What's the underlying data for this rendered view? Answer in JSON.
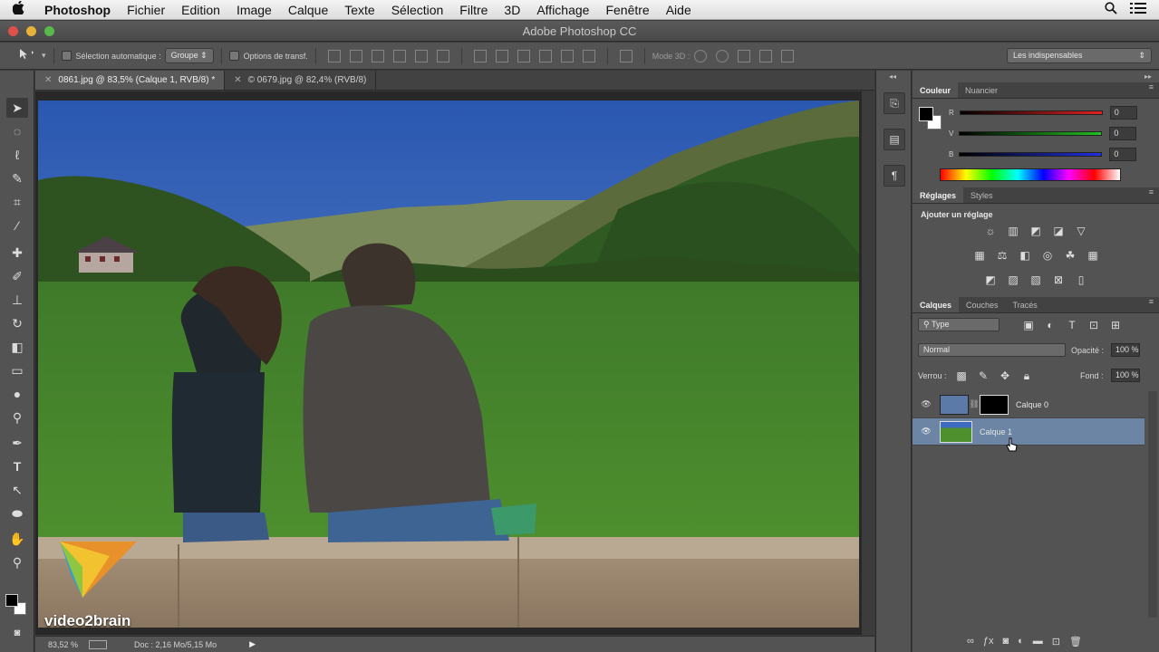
{
  "menubar": {
    "app": "Photoshop",
    "items": [
      "Fichier",
      "Edition",
      "Image",
      "Calque",
      "Texte",
      "Sélection",
      "Filtre",
      "3D",
      "Affichage",
      "Fenêtre",
      "Aide"
    ]
  },
  "window": {
    "title": "Adobe Photoshop CC"
  },
  "options_bar": {
    "auto_select_label": "Sélection automatique :",
    "auto_select_value": "Groupe",
    "transform_label": "Options de transf.",
    "mode3d_label": "Mode 3D :",
    "workspace": "Les indispensables"
  },
  "doc_tabs": [
    {
      "label": "0861.jpg @ 83,5% (Calque 1, RVB/8) *",
      "active": true
    },
    {
      "label": "© 0679.jpg @ 82,4% (RVB/8)",
      "active": false
    }
  ],
  "status_bar": {
    "zoom": "83,52 %",
    "doc": "Doc : 2,16 Mo/5,15 Mo"
  },
  "watermark": {
    "brand": "video2brain"
  },
  "color_panel": {
    "tabs": [
      "Couleur",
      "Nuancier"
    ],
    "channels": [
      {
        "label": "R",
        "value": "0"
      },
      {
        "label": "V",
        "value": "0"
      },
      {
        "label": "B",
        "value": "0"
      }
    ],
    "colors": {
      "r_bar": "#d42a2a",
      "g_bar": "#2ac42a",
      "b_bar": "#2a2ad4"
    }
  },
  "adjustments_panel": {
    "tabs": [
      "Réglages",
      "Styles"
    ],
    "heading": "Ajouter un réglage"
  },
  "layers_panel": {
    "tabs": [
      "Calques",
      "Couches",
      "Tracés"
    ],
    "filter": "Type",
    "blend_mode": "Normal",
    "opacity_label": "Opacité :",
    "opacity": "100 %",
    "lock_label": "Verrou :",
    "fill_label": "Fond :",
    "fill": "100 %",
    "layers": [
      {
        "name": "Calque 0",
        "selected": false
      },
      {
        "name": "Calque 1",
        "selected": true
      }
    ]
  }
}
